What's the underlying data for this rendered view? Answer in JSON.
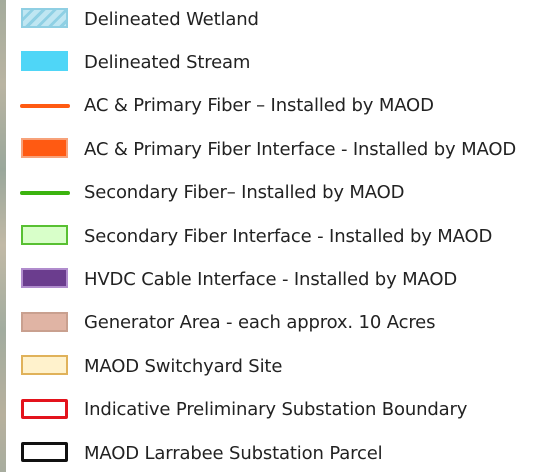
{
  "legend": {
    "items": [
      {
        "id": "wetland",
        "label": "Delineated Wetland",
        "kind": "hatch",
        "fill": "#bfe6f2",
        "stroke": "#8fcfe3",
        "hatch": "#8fd0e4"
      },
      {
        "id": "stream",
        "label": "Delineated Stream",
        "kind": "fill",
        "fill": "#4fd6f7",
        "stroke": "#4fd6f7"
      },
      {
        "id": "ac-fiber",
        "label": "AC & Primary Fiber – Installed by MAOD",
        "kind": "line",
        "stroke": "#ff5a12"
      },
      {
        "id": "ac-fiber-interface",
        "label": "AC & Primary Fiber Interface - Installed by MAOD",
        "kind": "fill",
        "fill": "#ff5a12",
        "stroke": "#f7a27a"
      },
      {
        "id": "secondary-fiber",
        "label": "Secondary Fiber– Installed by MAOD",
        "kind": "line",
        "stroke": "#3bb30f"
      },
      {
        "id": "secondary-fiber-interface",
        "label": "Secondary Fiber Interface - Installed by MAOD",
        "kind": "fill",
        "fill": "#d8ffc9",
        "stroke": "#58c032"
      },
      {
        "id": "hvdc",
        "label": "HVDC Cable Interface - Installed by MAOD",
        "kind": "fill",
        "fill": "#6b3d8e",
        "stroke": "#b08ccd"
      },
      {
        "id": "generator",
        "label": "Generator Area - each approx. 10 Acres",
        "kind": "fill",
        "fill": "#e0b4a4",
        "stroke": "#c9a08f"
      },
      {
        "id": "switchyard",
        "label": "MAOD Switchyard Site",
        "kind": "fill",
        "fill": "#fff2cc",
        "stroke": "#e0b25a"
      },
      {
        "id": "substation-boundary",
        "label": "Indicative Preliminary Substation Boundary",
        "kind": "outline",
        "fill": "#ffffff",
        "stroke": "#e3131c"
      },
      {
        "id": "larrabee-parcel",
        "label": "MAOD Larrabee Substation Parcel",
        "kind": "outline",
        "fill": "#ffffff",
        "stroke": "#111111"
      }
    ]
  }
}
